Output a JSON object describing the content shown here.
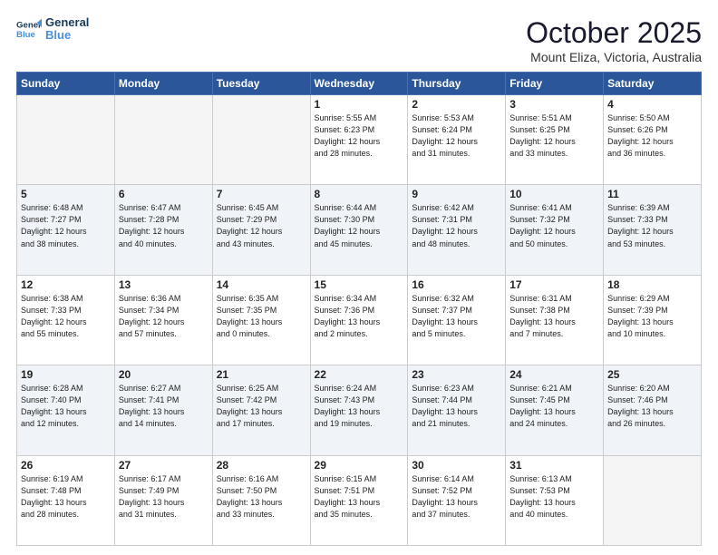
{
  "header": {
    "logo_line1": "General",
    "logo_line2": "Blue",
    "month": "October 2025",
    "location": "Mount Eliza, Victoria, Australia"
  },
  "weekdays": [
    "Sunday",
    "Monday",
    "Tuesday",
    "Wednesday",
    "Thursday",
    "Friday",
    "Saturday"
  ],
  "weeks": [
    [
      {
        "day": "",
        "info": ""
      },
      {
        "day": "",
        "info": ""
      },
      {
        "day": "",
        "info": ""
      },
      {
        "day": "1",
        "info": "Sunrise: 5:55 AM\nSunset: 6:23 PM\nDaylight: 12 hours\nand 28 minutes."
      },
      {
        "day": "2",
        "info": "Sunrise: 5:53 AM\nSunset: 6:24 PM\nDaylight: 12 hours\nand 31 minutes."
      },
      {
        "day": "3",
        "info": "Sunrise: 5:51 AM\nSunset: 6:25 PM\nDaylight: 12 hours\nand 33 minutes."
      },
      {
        "day": "4",
        "info": "Sunrise: 5:50 AM\nSunset: 6:26 PM\nDaylight: 12 hours\nand 36 minutes."
      }
    ],
    [
      {
        "day": "5",
        "info": "Sunrise: 6:48 AM\nSunset: 7:27 PM\nDaylight: 12 hours\nand 38 minutes."
      },
      {
        "day": "6",
        "info": "Sunrise: 6:47 AM\nSunset: 7:28 PM\nDaylight: 12 hours\nand 40 minutes."
      },
      {
        "day": "7",
        "info": "Sunrise: 6:45 AM\nSunset: 7:29 PM\nDaylight: 12 hours\nand 43 minutes."
      },
      {
        "day": "8",
        "info": "Sunrise: 6:44 AM\nSunset: 7:30 PM\nDaylight: 12 hours\nand 45 minutes."
      },
      {
        "day": "9",
        "info": "Sunrise: 6:42 AM\nSunset: 7:31 PM\nDaylight: 12 hours\nand 48 minutes."
      },
      {
        "day": "10",
        "info": "Sunrise: 6:41 AM\nSunset: 7:32 PM\nDaylight: 12 hours\nand 50 minutes."
      },
      {
        "day": "11",
        "info": "Sunrise: 6:39 AM\nSunset: 7:33 PM\nDaylight: 12 hours\nand 53 minutes."
      }
    ],
    [
      {
        "day": "12",
        "info": "Sunrise: 6:38 AM\nSunset: 7:33 PM\nDaylight: 12 hours\nand 55 minutes."
      },
      {
        "day": "13",
        "info": "Sunrise: 6:36 AM\nSunset: 7:34 PM\nDaylight: 12 hours\nand 57 minutes."
      },
      {
        "day": "14",
        "info": "Sunrise: 6:35 AM\nSunset: 7:35 PM\nDaylight: 13 hours\nand 0 minutes."
      },
      {
        "day": "15",
        "info": "Sunrise: 6:34 AM\nSunset: 7:36 PM\nDaylight: 13 hours\nand 2 minutes."
      },
      {
        "day": "16",
        "info": "Sunrise: 6:32 AM\nSunset: 7:37 PM\nDaylight: 13 hours\nand 5 minutes."
      },
      {
        "day": "17",
        "info": "Sunrise: 6:31 AM\nSunset: 7:38 PM\nDaylight: 13 hours\nand 7 minutes."
      },
      {
        "day": "18",
        "info": "Sunrise: 6:29 AM\nSunset: 7:39 PM\nDaylight: 13 hours\nand 10 minutes."
      }
    ],
    [
      {
        "day": "19",
        "info": "Sunrise: 6:28 AM\nSunset: 7:40 PM\nDaylight: 13 hours\nand 12 minutes."
      },
      {
        "day": "20",
        "info": "Sunrise: 6:27 AM\nSunset: 7:41 PM\nDaylight: 13 hours\nand 14 minutes."
      },
      {
        "day": "21",
        "info": "Sunrise: 6:25 AM\nSunset: 7:42 PM\nDaylight: 13 hours\nand 17 minutes."
      },
      {
        "day": "22",
        "info": "Sunrise: 6:24 AM\nSunset: 7:43 PM\nDaylight: 13 hours\nand 19 minutes."
      },
      {
        "day": "23",
        "info": "Sunrise: 6:23 AM\nSunset: 7:44 PM\nDaylight: 13 hours\nand 21 minutes."
      },
      {
        "day": "24",
        "info": "Sunrise: 6:21 AM\nSunset: 7:45 PM\nDaylight: 13 hours\nand 24 minutes."
      },
      {
        "day": "25",
        "info": "Sunrise: 6:20 AM\nSunset: 7:46 PM\nDaylight: 13 hours\nand 26 minutes."
      }
    ],
    [
      {
        "day": "26",
        "info": "Sunrise: 6:19 AM\nSunset: 7:48 PM\nDaylight: 13 hours\nand 28 minutes."
      },
      {
        "day": "27",
        "info": "Sunrise: 6:17 AM\nSunset: 7:49 PM\nDaylight: 13 hours\nand 31 minutes."
      },
      {
        "day": "28",
        "info": "Sunrise: 6:16 AM\nSunset: 7:50 PM\nDaylight: 13 hours\nand 33 minutes."
      },
      {
        "day": "29",
        "info": "Sunrise: 6:15 AM\nSunset: 7:51 PM\nDaylight: 13 hours\nand 35 minutes."
      },
      {
        "day": "30",
        "info": "Sunrise: 6:14 AM\nSunset: 7:52 PM\nDaylight: 13 hours\nand 37 minutes."
      },
      {
        "day": "31",
        "info": "Sunrise: 6:13 AM\nSunset: 7:53 PM\nDaylight: 13 hours\nand 40 minutes."
      },
      {
        "day": "",
        "info": ""
      }
    ]
  ]
}
